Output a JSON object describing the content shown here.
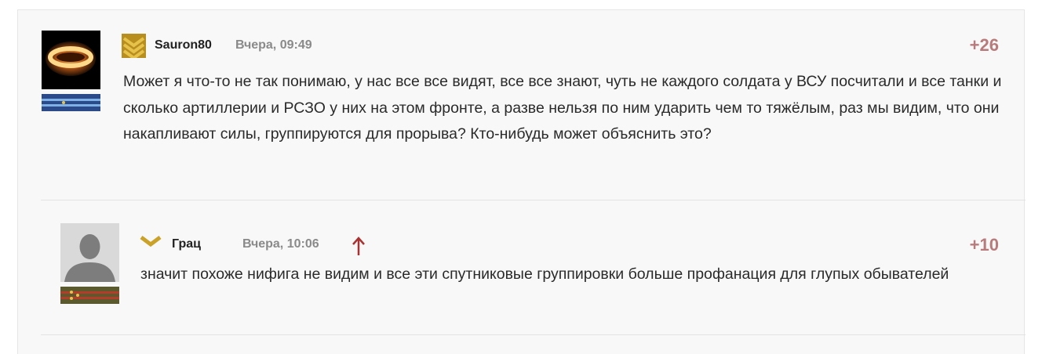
{
  "colors": {
    "panel_bg": "#f8f8f8",
    "author": "#222222",
    "date": "#8a8a8a",
    "score": "#b87a7a",
    "text": "#2a2a2a",
    "rank_gold": "#c9a227",
    "reply_arrow": "#a83232"
  },
  "comments": [
    {
      "author": "Sauron80",
      "date": "Вчера, 09:49",
      "score": "+26",
      "avatar_icon": "ring-avatar",
      "rank_icon": "sergeant-chevron-icon",
      "text": "Может я что-то не так понимаю, у нас все все видят, все все знают, чуть не каждого солдата у ВСУ посчитали и все танки и сколько артиллерии и РСЗО у них на этом фронте, а разве нельзя по ним ударить чем то тяжёлым, раз мы видим, что они накапливают силы, группируются для прорыва? Кто-нибудь может объяснить это?"
    },
    {
      "author": "Грац",
      "date": "Вчера, 10:06",
      "score": "+10",
      "avatar_icon": "default-silhouette-avatar",
      "rank_icon": "corporal-chevron-icon",
      "reply_icon": "arrow-up-icon",
      "text": "значит похоже нифига не видим и все эти спутниковые группировки больше профанация для глупых обывателей"
    }
  ]
}
